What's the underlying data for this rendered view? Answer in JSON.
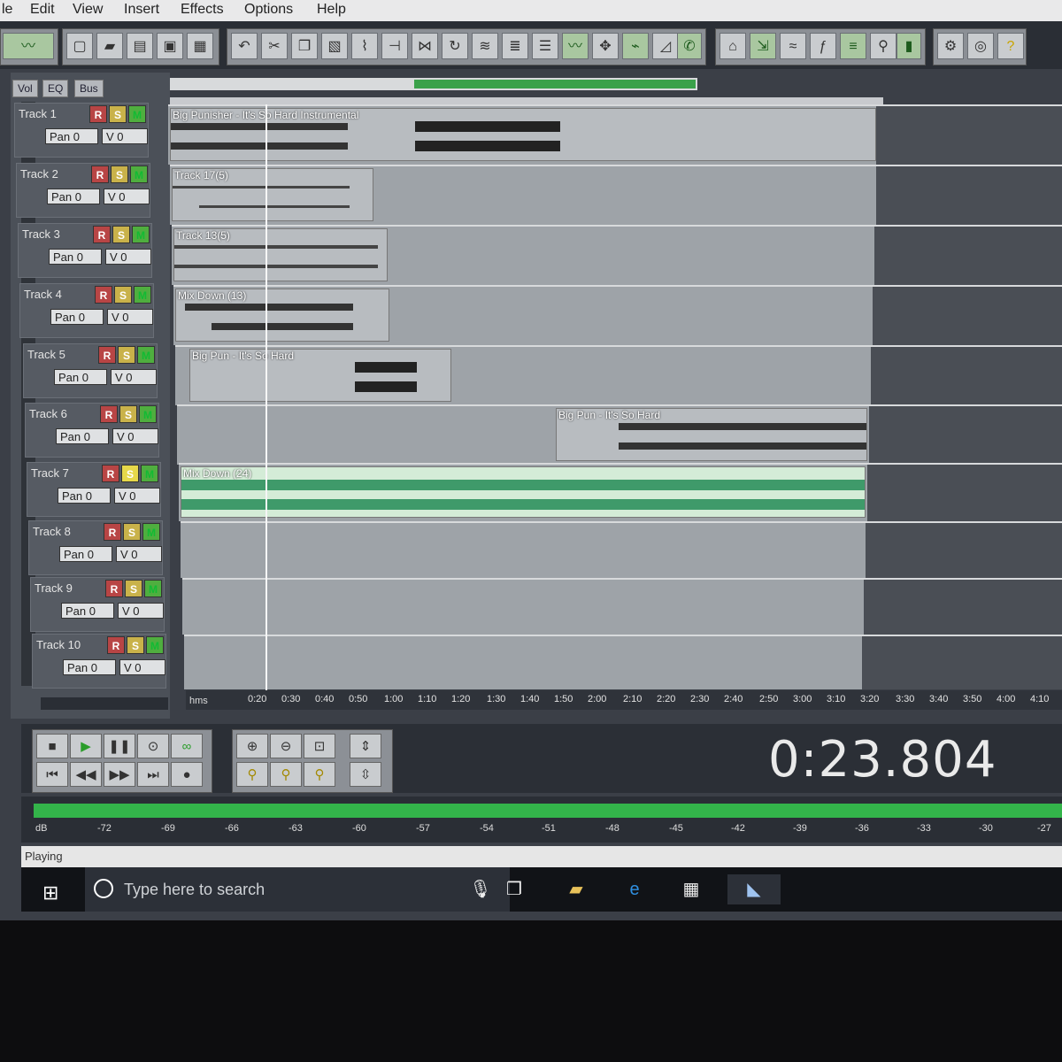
{
  "menu": [
    "le",
    "Edit",
    "View",
    "Insert",
    "Effects",
    "Options",
    "Help"
  ],
  "panel_tabs": [
    "Vol",
    "EQ",
    "Bus"
  ],
  "tracks": [
    {
      "name": "Track 1",
      "r": "R",
      "s": "S",
      "m": "M",
      "pan": "Pan 0",
      "vol": "V 0"
    },
    {
      "name": "Track 2",
      "r": "R",
      "s": "S",
      "m": "M",
      "pan": "Pan 0",
      "vol": "V 0"
    },
    {
      "name": "Track 3",
      "r": "R",
      "s": "S",
      "m": "M",
      "pan": "Pan 0",
      "vol": "V 0"
    },
    {
      "name": "Track 4",
      "r": "R",
      "s": "S",
      "m": "M",
      "pan": "Pan 0",
      "vol": "V 0"
    },
    {
      "name": "Track 5",
      "r": "R",
      "s": "S",
      "m": "M",
      "pan": "Pan 0",
      "vol": "V 0"
    },
    {
      "name": "Track 6",
      "r": "R",
      "s": "S",
      "m": "M",
      "pan": "Pan 0",
      "vol": "V 0"
    },
    {
      "name": "Track 7",
      "r": "R",
      "s": "S",
      "m": "M",
      "pan": "Pan 0",
      "vol": "V 0"
    },
    {
      "name": "Track 8",
      "r": "R",
      "s": "S",
      "m": "M",
      "pan": "Pan 0",
      "vol": "V 0"
    },
    {
      "name": "Track 9",
      "r": "R",
      "s": "S",
      "m": "M",
      "pan": "Pan 0",
      "vol": "V 0"
    },
    {
      "name": "Track 10",
      "r": "R",
      "s": "S",
      "m": "M",
      "pan": "Pan 0",
      "vol": "V 0"
    }
  ],
  "clips": [
    "Big Punisher - It's So Hard Instrumental",
    "Track 17(5)",
    "Track 13(5)",
    "Mix Down (13)",
    "Big Pun - It's So Hard",
    "Big Pun - It's So Hard",
    "Mix Down (24)"
  ],
  "timeline": {
    "unit": "hms",
    "ticks": [
      "0:20",
      "0:30",
      "0:40",
      "0:50",
      "1:00",
      "1:10",
      "1:20",
      "1:30",
      "1:40",
      "1:50",
      "2:00",
      "2:10",
      "2:20",
      "2:30",
      "2:40",
      "2:50",
      "3:00",
      "3:10",
      "3:20",
      "3:30",
      "3:40",
      "3:50",
      "4:00",
      "4:10"
    ]
  },
  "transport": {
    "buttons": [
      "stop-icon",
      "play-icon",
      "pause-icon",
      "record-loop-icon",
      "loop-icon",
      "go-start-icon",
      "rewind-icon",
      "fast-forward-icon",
      "go-end-icon",
      "record-icon"
    ],
    "zoom_buttons": [
      "zoom-in-icon",
      "zoom-out-icon",
      "zoom-selection-icon",
      "zoom-vertical-in-icon",
      "zoom-full-icon",
      "zoom-out-full-icon",
      "zoom-fit-icon",
      "zoom-vertical-out-icon"
    ]
  },
  "clock": "0:23.804",
  "meter": {
    "ticks": [
      "dB",
      "-72",
      "-69",
      "-66",
      "-63",
      "-60",
      "-57",
      "-54",
      "-51",
      "-48",
      "-45",
      "-42",
      "-39",
      "-36",
      "-33",
      "-30",
      "-27"
    ]
  },
  "status": "Playing",
  "taskbar": {
    "search_placeholder": "Type here to search",
    "apps": [
      "mic-icon",
      "task-view-icon",
      "file-explorer-icon",
      "edge-icon",
      "store-icon",
      "audio-editor-icon"
    ]
  },
  "colors": {
    "accent_green": "#3aa14a",
    "record_red": "#b84545",
    "solo_yellow": "#c9b24a",
    "mute_green": "#4fae3f"
  }
}
